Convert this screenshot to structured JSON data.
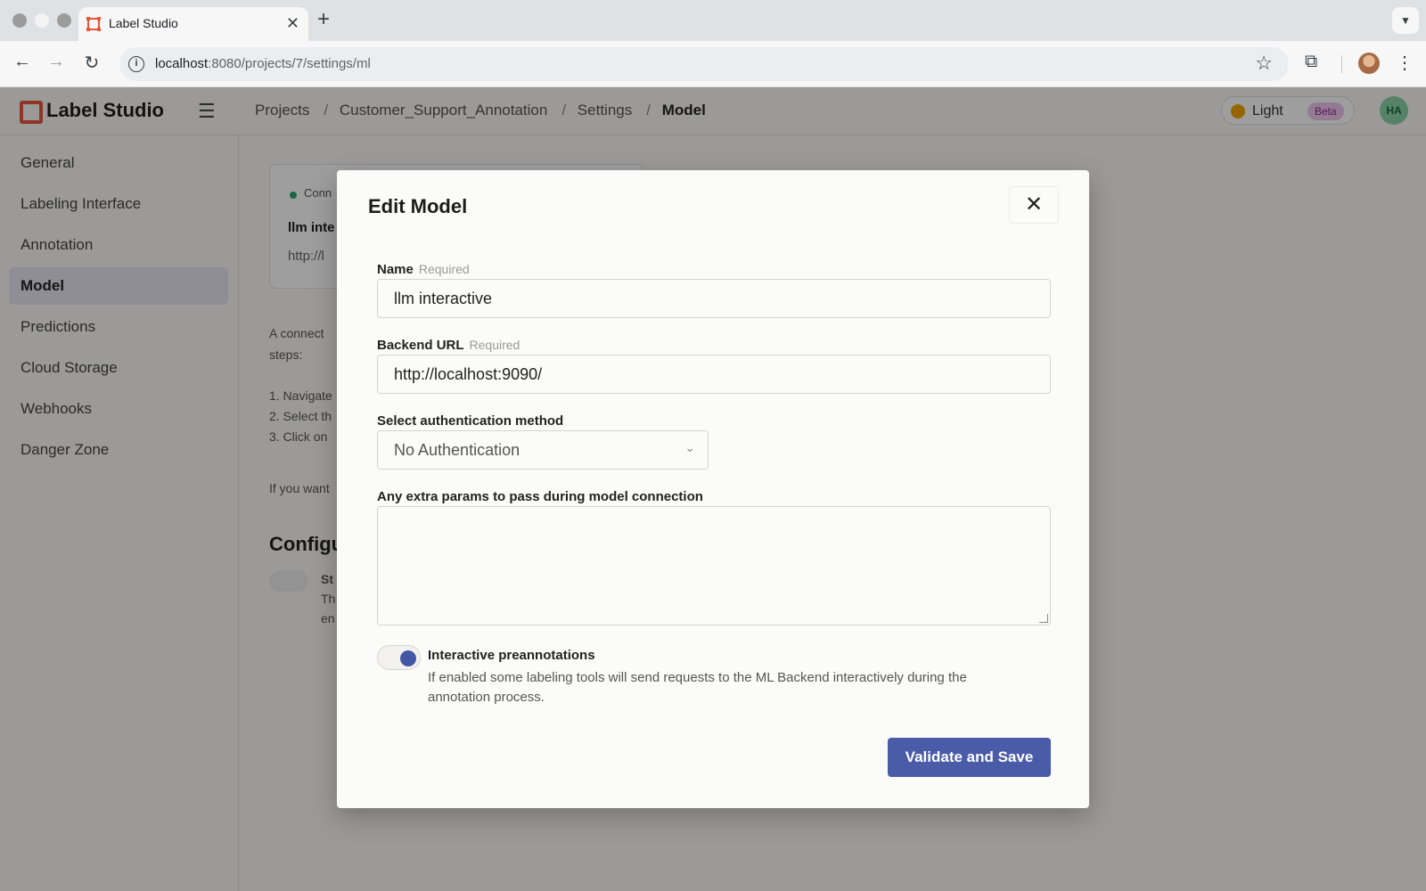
{
  "browser": {
    "tab_title": "Label Studio",
    "new_tab_symbol": "+",
    "url_host": "localhost",
    "url_rest": ":8080/projects/7/settings/ml"
  },
  "app": {
    "logo_text": "Label Studio",
    "breadcrumb": [
      "Projects",
      "Customer_Support_Annotation",
      "Settings",
      "Model"
    ],
    "theme_label": "Light",
    "beta_label": "Beta",
    "user_initials": "HA"
  },
  "sidebar": {
    "items": [
      {
        "label": "General"
      },
      {
        "label": "Labeling Interface"
      },
      {
        "label": "Annotation"
      },
      {
        "label": "Model"
      },
      {
        "label": "Predictions"
      },
      {
        "label": "Cloud Storage"
      },
      {
        "label": "Webhooks"
      },
      {
        "label": "Danger Zone"
      }
    ],
    "active_index": 3
  },
  "background": {
    "status_text": "Conn",
    "card_name": "llm inte",
    "card_url": "http://l",
    "intro_line1": "A connect",
    "intro_line2": "steps:",
    "step1": "1. Navigate",
    "step2": "2. Select th",
    "step3": "3. Click on",
    "footer_text": "If you want",
    "config_heading": "Configu",
    "option_title": "St",
    "option_line1": "Th",
    "option_line2": "en"
  },
  "modal": {
    "title": "Edit Model",
    "name_label": "Name",
    "name_required": "Required",
    "name_value": "llm interactive",
    "backend_label": "Backend URL",
    "backend_required": "Required",
    "backend_value": "http://localhost:9090/",
    "auth_label": "Select authentication method",
    "auth_value": "No Authentication",
    "extra_label": "Any extra params to pass during model connection",
    "extra_value": "",
    "interactive_title": "Interactive preannotations",
    "interactive_desc": "If enabled some labeling tools will send requests to the ML Backend interactively during the annotation process.",
    "interactive_enabled": true,
    "submit_label": "Validate and Save"
  },
  "colors": {
    "primary": "#4a5ba8",
    "logo": "#e8563a"
  }
}
